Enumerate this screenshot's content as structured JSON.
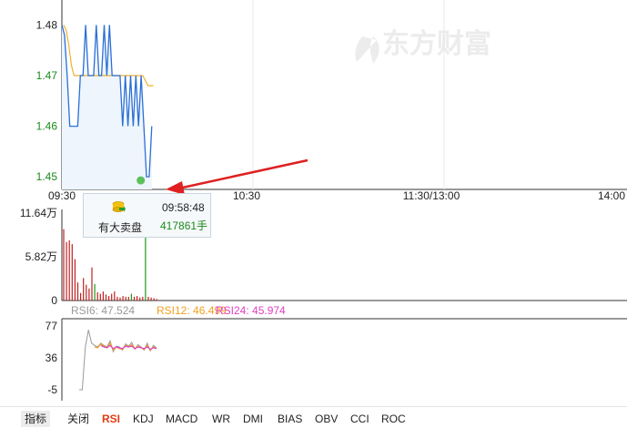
{
  "watermark": "东方财富",
  "price_chart": {
    "y_ticks": [
      "1.48",
      "1.47",
      "1.46",
      "1.45"
    ],
    "x_ticks": [
      "09:30",
      "10:30",
      "11:30/13:00",
      "14:00"
    ]
  },
  "volume_chart": {
    "y_ticks": [
      "11.64万",
      "5.82万",
      "0"
    ]
  },
  "rsi": {
    "legend": [
      {
        "text": "RSI6: 47.524",
        "color": "#999999"
      },
      {
        "text": "RSI12: 46.499",
        "color": "#f0a020"
      },
      {
        "text": "RSI24: 45.974",
        "color": "#e040c0"
      }
    ],
    "y_ticks": [
      "77",
      "36",
      "-5"
    ]
  },
  "tooltip": {
    "label": "有大卖盘",
    "time": "09:58:48",
    "volume": "417861手"
  },
  "tabs": {
    "header": "指标",
    "items": [
      "关闭",
      "RSI",
      "KDJ",
      "MACD",
      "WR",
      "DMI",
      "BIAS",
      "OBV",
      "CCI",
      "ROC"
    ],
    "active": "RSI"
  },
  "chart_data": {
    "type": "line",
    "price": {
      "ylim": [
        1.4475,
        1.4835
      ],
      "minute": [
        0,
        1,
        2,
        3,
        4,
        5,
        6,
        7,
        8,
        9,
        10,
        11,
        12,
        13,
        14,
        15,
        16,
        17,
        18,
        19,
        20,
        21,
        22,
        23,
        24,
        25,
        26,
        27,
        28,
        29,
        30,
        31,
        32,
        33,
        34
      ],
      "values": [
        1.48,
        1.478,
        1.47,
        1.46,
        1.46,
        1.46,
        1.46,
        1.47,
        1.47,
        1.48,
        1.47,
        1.47,
        1.47,
        1.48,
        1.47,
        1.47,
        1.48,
        1.47,
        1.48,
        1.47,
        1.47,
        1.47,
        1.47,
        1.46,
        1.47,
        1.46,
        1.47,
        1.46,
        1.47,
        1.46,
        1.47,
        1.46,
        1.45,
        1.45,
        1.46
      ],
      "avg": [
        1.48,
        1.479,
        1.476,
        1.472,
        1.47,
        1.47,
        1.47,
        1.47,
        1.47,
        1.47,
        1.47,
        1.47,
        1.47,
        1.47,
        1.47,
        1.47,
        1.47,
        1.47,
        1.47,
        1.47,
        1.47,
        1.47,
        1.47,
        1.47,
        1.47,
        1.47,
        1.47,
        1.47,
        1.47,
        1.47,
        1.47,
        1.469,
        1.468,
        1.468,
        1.468
      ],
      "marker_minute": 29,
      "marker_value": 1.45
    },
    "volume": {
      "ylim": [
        0,
        116400
      ],
      "values": [
        95000,
        78000,
        80000,
        75000,
        55000,
        24000,
        10000,
        30000,
        21000,
        16000,
        44000,
        22000,
        11000,
        9000,
        12000,
        8000,
        6000,
        9000,
        12000,
        5000,
        4000,
        6000,
        5000,
        5000,
        9000,
        5000,
        6000,
        4000,
        5000,
        417861,
        5000,
        4000,
        3000,
        2000
      ],
      "colors": [
        "red",
        "red",
        "red",
        "red",
        "red",
        "red",
        "red",
        "red",
        "red",
        "red",
        "red",
        "green",
        "red",
        "red",
        "red",
        "red",
        "red",
        "red",
        "red",
        "red",
        "red",
        "red",
        "red",
        "red",
        "green",
        "red",
        "red",
        "red",
        "red",
        "green",
        "red",
        "red",
        "red",
        "red"
      ]
    },
    "rsi": {
      "ylim": [
        -5,
        77
      ],
      "rsi6": [
        -5,
        -5,
        50,
        72,
        55,
        52,
        50,
        55,
        52,
        50,
        58,
        44,
        51,
        50,
        46,
        54,
        51,
        56,
        47,
        53,
        50,
        46,
        55,
        45,
        52,
        49
      ],
      "rsi12": [
        null,
        null,
        null,
        null,
        null,
        50,
        49,
        54,
        51,
        49,
        55,
        46,
        50,
        48,
        47,
        52,
        50,
        53,
        48,
        51,
        49,
        47,
        52,
        46,
        50,
        48
      ],
      "rsi24": [
        null,
        null,
        null,
        null,
        null,
        null,
        null,
        52,
        50,
        49,
        52,
        48,
        50,
        49,
        48,
        51,
        50,
        51,
        48,
        50,
        49,
        48,
        50,
        47,
        49,
        48
      ]
    }
  }
}
